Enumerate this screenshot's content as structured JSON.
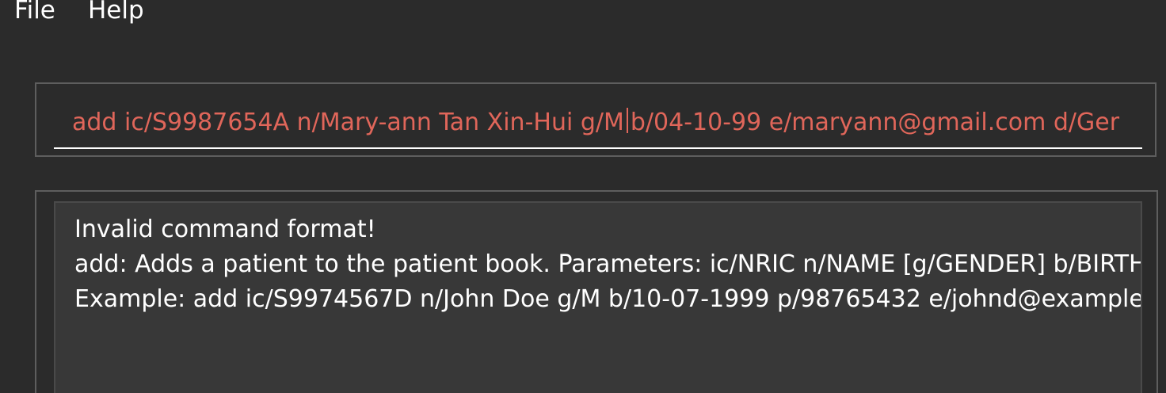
{
  "menubar": {
    "items": [
      {
        "label": "File"
      },
      {
        "label": "Help"
      }
    ]
  },
  "command_box": {
    "value_before_caret": "add ic/S9987654A n/Mary-ann Tan Xin-Hui g/M",
    "value_after_caret": "b/04-10-99 e/maryann@gmail.com d/Ger"
  },
  "result_display": {
    "lines": [
      "Invalid command format!",
      "add: Adds a patient to the patient book. Parameters: ic/NRIC n/NAME [g/GENDER] b/BIRTHDA",
      "Example: add ic/S9974567D n/John Doe g/M b/10-07-1999 p/98765432 e/johnd@example"
    ]
  },
  "colors": {
    "background": "#2b2b2b",
    "command_text": "#e0665a",
    "result_text": "#ffffff",
    "result_background": "#383838"
  }
}
